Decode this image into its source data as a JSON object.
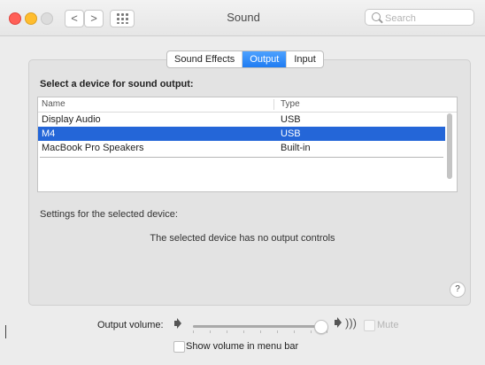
{
  "window": {
    "title": "Sound",
    "search_placeholder": "Search",
    "back_glyph": "<",
    "forward_glyph": ">"
  },
  "tabs": [
    {
      "label": "Sound Effects",
      "active": false
    },
    {
      "label": "Output",
      "active": true
    },
    {
      "label": "Input",
      "active": false
    }
  ],
  "output": {
    "select_label": "Select a device for sound output:",
    "columns": [
      "Name",
      "Type"
    ],
    "devices": [
      {
        "name": "Display Audio",
        "type": "USB",
        "selected": false
      },
      {
        "name": "M4",
        "type": "USB",
        "selected": true
      },
      {
        "name": "MacBook Pro Speakers",
        "type": "Built-in",
        "selected": false
      }
    ],
    "settings_label": "Settings for the selected device:",
    "no_controls_text": "The selected device has no output controls",
    "help_glyph": "?"
  },
  "volume": {
    "label": "Output volume:",
    "level": 0.95,
    "mute_label": "Mute",
    "muted": false,
    "show_in_menubar_label": "Show volume in menu bar",
    "show_in_menubar": false
  },
  "colors": {
    "accent": "#1f7cf2",
    "selection": "#2466d8",
    "close": "#ff5f57",
    "minimize": "#ffbd2e"
  },
  "icons": [
    "close-icon",
    "minimize-icon",
    "zoom-icon",
    "back-icon",
    "forward-icon",
    "show-all-icon",
    "search-icon",
    "speaker-low-icon",
    "speaker-high-icon",
    "help-icon"
  ]
}
